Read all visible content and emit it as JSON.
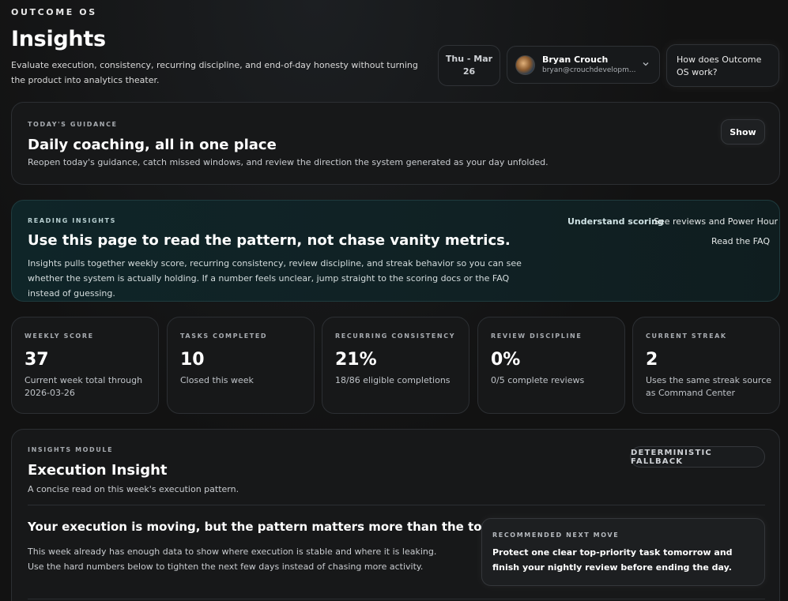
{
  "header": {
    "brand": "OUTCOME OS",
    "title": "Insights",
    "subtitle": "Evaluate execution, consistency, recurring discipline, and end-of-day honesty without turning the product into analytics theater.",
    "date_range_line1": "Thu - Mar",
    "date_range_line2": "26",
    "user_name": "Bryan Crouch",
    "user_email": "bryan@crouchdevelopm...",
    "help_label": "How does Outcome OS work?"
  },
  "guidance": {
    "eyebrow": "TODAY'S GUIDANCE",
    "title": "Daily coaching, all in one place",
    "description": "Reopen today's guidance, catch missed windows, and review the direction the system generated as your day unfolded.",
    "show_label": "Show"
  },
  "reading": {
    "eyebrow": "READING INSIGHTS",
    "title": "Use this page to read the pattern, not chase vanity metrics.",
    "description": "Insights pulls together weekly score, recurring consistency, review discipline, and streak behavior so you can see whether the system is actually holding. If a number feels unclear, jump straight to the scoring docs or the FAQ instead of guessing.",
    "link_scoring": "Understand scoring",
    "link_reviews": "See reviews and Power Hour",
    "link_faq": "Read the FAQ"
  },
  "stats": [
    {
      "label": "WEEKLY SCORE",
      "value": "37",
      "note": "Current week total through 2026-03-26"
    },
    {
      "label": "TASKS COMPLETED",
      "value": "10",
      "note": "Closed this week"
    },
    {
      "label": "RECURRING CONSISTENCY",
      "value": "21%",
      "note": "18/86 eligible completions"
    },
    {
      "label": "REVIEW DISCIPLINE",
      "value": "0%",
      "note": "0/5 complete reviews"
    },
    {
      "label": "CURRENT STREAK",
      "value": "2",
      "note": "Uses the same streak source as Command Center"
    }
  ],
  "module": {
    "eyebrow": "INSIGHTS MODULE",
    "title": "Execution Insight",
    "subtitle": "A concise read on this week's execution pattern.",
    "badge": "DETERMINISTIC FALLBACK",
    "headline": "Your execution is moving, but the pattern matters more than the total.",
    "body": "This week already has enough data to show where execution is stable and where it is leaking. Use the hard numbers below to tighten the next few days instead of chasing more activity.",
    "next_move_eyebrow": "RECOMMENDED NEXT MOVE",
    "next_move_text": "Protect one clear top-priority task tomorrow and finish your nightly review before ending the day."
  }
}
